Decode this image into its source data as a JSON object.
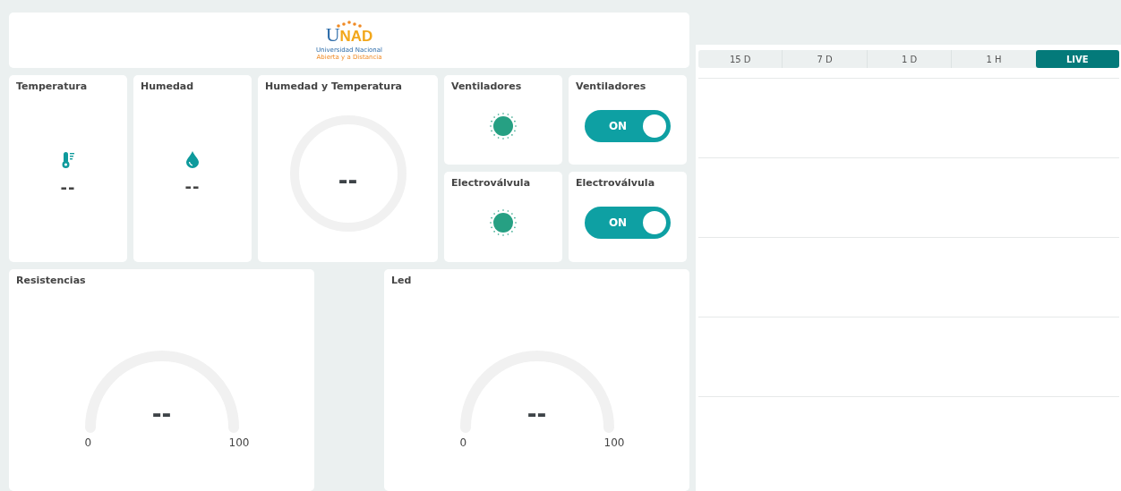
{
  "logo": {
    "mark_first": "U",
    "mark_rest": "NAD",
    "line1": "Universidad Nacional",
    "line2": "Abierta y a Distancia"
  },
  "widgets": [
    {
      "kind": "thermo-value",
      "title": "Temperatura",
      "value": "--"
    },
    {
      "kind": "drop-value",
      "title": "Humedad",
      "value": "--"
    },
    {
      "kind": "ring",
      "title": "Humedad y Temperatura",
      "value": "--"
    },
    {
      "kind": "indicator",
      "title": "Ventiladores",
      "on": true
    },
    {
      "kind": "switch",
      "title": "Ventiladores",
      "on": true,
      "label": "ON"
    },
    {
      "kind": "indicator",
      "title": "Electroválvula",
      "on": true
    },
    {
      "kind": "switch",
      "title": "Electroválvula",
      "on": true,
      "label": "ON"
    }
  ],
  "gauges": [
    {
      "title": "Resistencias",
      "value": "--",
      "min": "0",
      "max": "100"
    },
    {
      "title": "Led",
      "value": "--",
      "min": "0",
      "max": "100"
    }
  ],
  "chart_panel": {
    "tabs": [
      {
        "label": "15 D",
        "selected": false
      },
      {
        "label": "7 D",
        "selected": false
      },
      {
        "label": "1 D",
        "selected": false
      },
      {
        "label": "1 H",
        "selected": false
      },
      {
        "label": "LIVE",
        "selected": true
      }
    ]
  }
}
